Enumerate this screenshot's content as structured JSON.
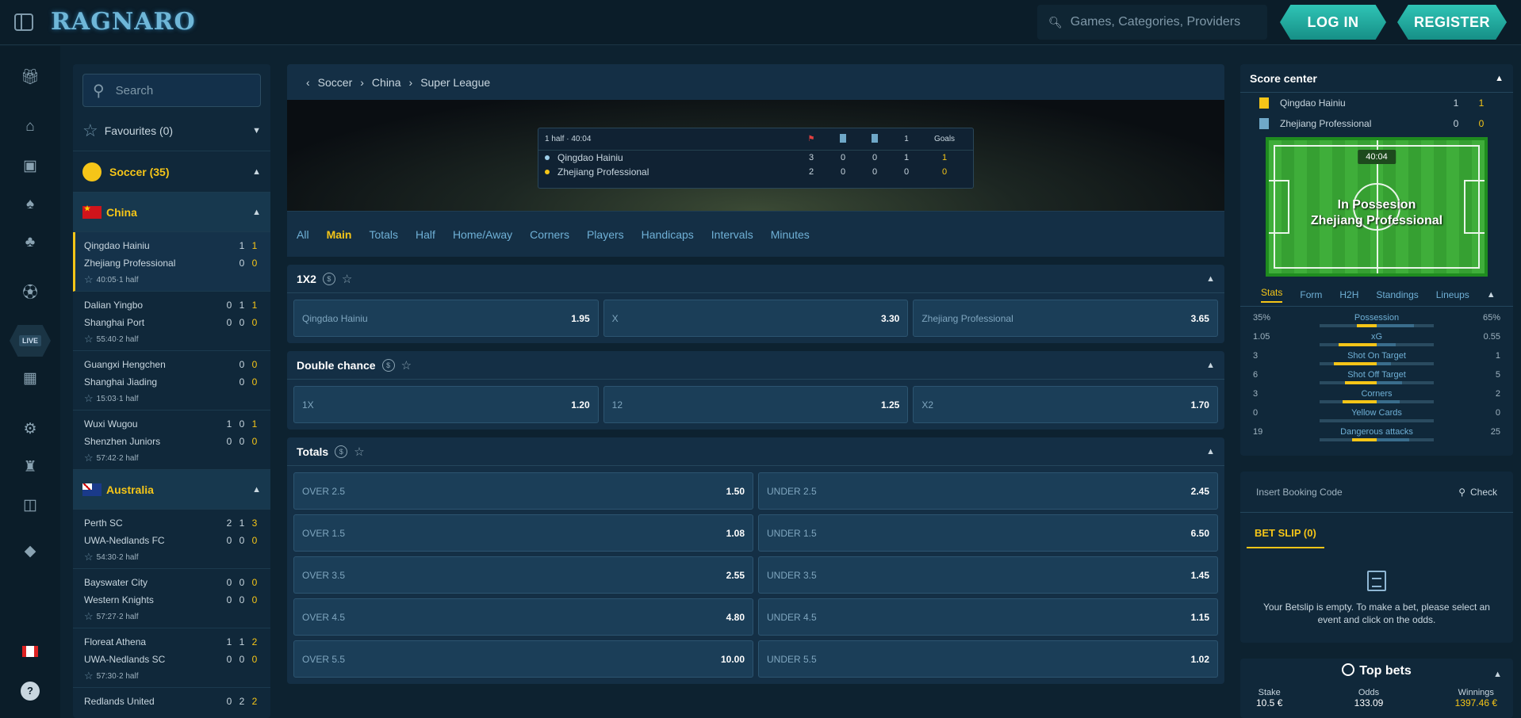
{
  "header": {
    "logo": "RAGNARO",
    "search_placeholder": "Games, Categories, Providers",
    "login": "LOG IN",
    "register": "REGISTER"
  },
  "rail": [
    "gift-icon",
    "home-icon",
    "slot-machine-icon",
    "cards-icon",
    "clover-icon",
    "soccer-icon",
    "live-icon",
    "esports-icon",
    "virtual-icon",
    "tournament-icon",
    "shop-icon",
    "vip-icon"
  ],
  "rail_live": "LIVE",
  "left": {
    "search_placeholder": "Search",
    "favourites": "Favourites (0)",
    "soccer": "Soccer (35)",
    "china": "China",
    "australia": "Australia",
    "matches_china": [
      {
        "t1": "Qingdao Hainiu",
        "t2": "Zhejiang Professional",
        "s1": [
          "1",
          "1"
        ],
        "s2": [
          "0",
          "0"
        ],
        "time": "40:05·1 half"
      },
      {
        "t1": "Dalian Yingbo",
        "t2": "Shanghai Port",
        "s1": [
          "0",
          "1",
          "1"
        ],
        "s2": [
          "0",
          "0",
          "0"
        ],
        "time": "55:40·2 half"
      },
      {
        "t1": "Guangxi Hengchen",
        "t2": "Shanghai Jiading",
        "s1": [
          "0",
          "0"
        ],
        "s2": [
          "0",
          "0"
        ],
        "time": "15:03·1 half"
      },
      {
        "t1": "Wuxi Wugou",
        "t2": "Shenzhen Juniors",
        "s1": [
          "1",
          "0",
          "1"
        ],
        "s2": [
          "0",
          "0",
          "0"
        ],
        "time": "57:42·2 half"
      }
    ],
    "matches_australia": [
      {
        "t1": "Perth SC",
        "t2": "UWA-Nedlands FC",
        "s1": [
          "2",
          "1",
          "3"
        ],
        "s2": [
          "0",
          "0",
          "0"
        ],
        "time": "54:30·2 half"
      },
      {
        "t1": "Bayswater City",
        "t2": "Western Knights",
        "s1": [
          "0",
          "0",
          "0"
        ],
        "s2": [
          "0",
          "0",
          "0"
        ],
        "time": "57:27·2 half"
      },
      {
        "t1": "Floreat Athena",
        "t2": "UWA-Nedlands SC",
        "s1": [
          "1",
          "1",
          "2"
        ],
        "s2": [
          "0",
          "0",
          "0"
        ],
        "time": "57:30·2 half"
      },
      {
        "t1": "Redlands United",
        "t2": "",
        "s1": [
          "0",
          "2",
          "2"
        ],
        "s2": [],
        "time": ""
      }
    ]
  },
  "center": {
    "breadcrumb": [
      "Soccer",
      "China",
      "Super League"
    ],
    "scoreboard": {
      "period": "1 half · 40:04",
      "col_last": "1",
      "col_goals": "Goals",
      "home": {
        "name": "Qingdao Hainiu",
        "vals": [
          "3",
          "0",
          "0",
          "1",
          "1"
        ]
      },
      "away": {
        "name": "Zhejiang Professional",
        "vals": [
          "2",
          "0",
          "0",
          "0",
          "0"
        ]
      }
    },
    "tabs": [
      "All",
      "Main",
      "Totals",
      "Half",
      "Home/Away",
      "Corners",
      "Players",
      "Handicaps",
      "Intervals",
      "Minutes"
    ],
    "active_tab": "Main",
    "markets": {
      "m1x2": {
        "title": "1X2",
        "odds": [
          [
            "Qingdao Hainiu",
            "1.95"
          ],
          [
            "X",
            "3.30"
          ],
          [
            "Zhejiang Professional",
            "3.65"
          ]
        ]
      },
      "double": {
        "title": "Double chance",
        "odds": [
          [
            "1X",
            "1.20"
          ],
          [
            "12",
            "1.25"
          ],
          [
            "X2",
            "1.70"
          ]
        ]
      },
      "totals": {
        "title": "Totals",
        "odds": [
          [
            "OVER 2.5",
            "1.50"
          ],
          [
            "UNDER 2.5",
            "2.45"
          ],
          [
            "OVER 1.5",
            "1.08"
          ],
          [
            "UNDER 1.5",
            "6.50"
          ],
          [
            "OVER 3.5",
            "2.55"
          ],
          [
            "UNDER 3.5",
            "1.45"
          ],
          [
            "OVER 4.5",
            "4.80"
          ],
          [
            "UNDER 4.5",
            "1.15"
          ],
          [
            "OVER 5.5",
            "10.00"
          ],
          [
            "UNDER 5.5",
            "1.02"
          ]
        ]
      }
    }
  },
  "right": {
    "score_center": "Score center",
    "team1": {
      "name": "Qingdao Hainiu",
      "a": "1",
      "b": "1"
    },
    "team2": {
      "name": "Zhejiang Professional",
      "a": "0",
      "b": "0"
    },
    "clock": "40:04",
    "possession_label": "In Possesion",
    "possession_team": "Zhejiang Professional",
    "tabs": [
      "Stats",
      "Form",
      "H2H",
      "Standings",
      "Lineups"
    ],
    "stats": [
      {
        "l": "35%",
        "m": "Possession",
        "r": "65%",
        "lv": 0.35,
        "rv": 0.65
      },
      {
        "l": "1.05",
        "m": "xG",
        "r": "0.55",
        "lv": 0.66,
        "rv": 0.34
      },
      {
        "l": "3",
        "m": "Shot On Target",
        "r": "1",
        "lv": 0.75,
        "rv": 0.25
      },
      {
        "l": "6",
        "m": "Shot Off Target",
        "r": "5",
        "lv": 0.55,
        "rv": 0.45
      },
      {
        "l": "3",
        "m": "Corners",
        "r": "2",
        "lv": 0.6,
        "rv": 0.4
      },
      {
        "l": "0",
        "m": "Yellow Cards",
        "r": "0",
        "lv": 0,
        "rv": 0
      },
      {
        "l": "19",
        "m": "Dangerous attacks",
        "r": "25",
        "lv": 0.43,
        "rv": 0.57
      }
    ],
    "booking_placeholder": "Insert Booking Code",
    "check": "Check",
    "betslip": "BET SLIP (0)",
    "empty_msg": "Your Betslip is empty. To make a bet, please select an event and click on the odds.",
    "top_bets": "Top bets",
    "stake_label": "Stake",
    "stake": "10.5 €",
    "odds_label": "Odds",
    "odds": "133.09",
    "win_label": "Winnings",
    "win": "1397.46 €"
  }
}
